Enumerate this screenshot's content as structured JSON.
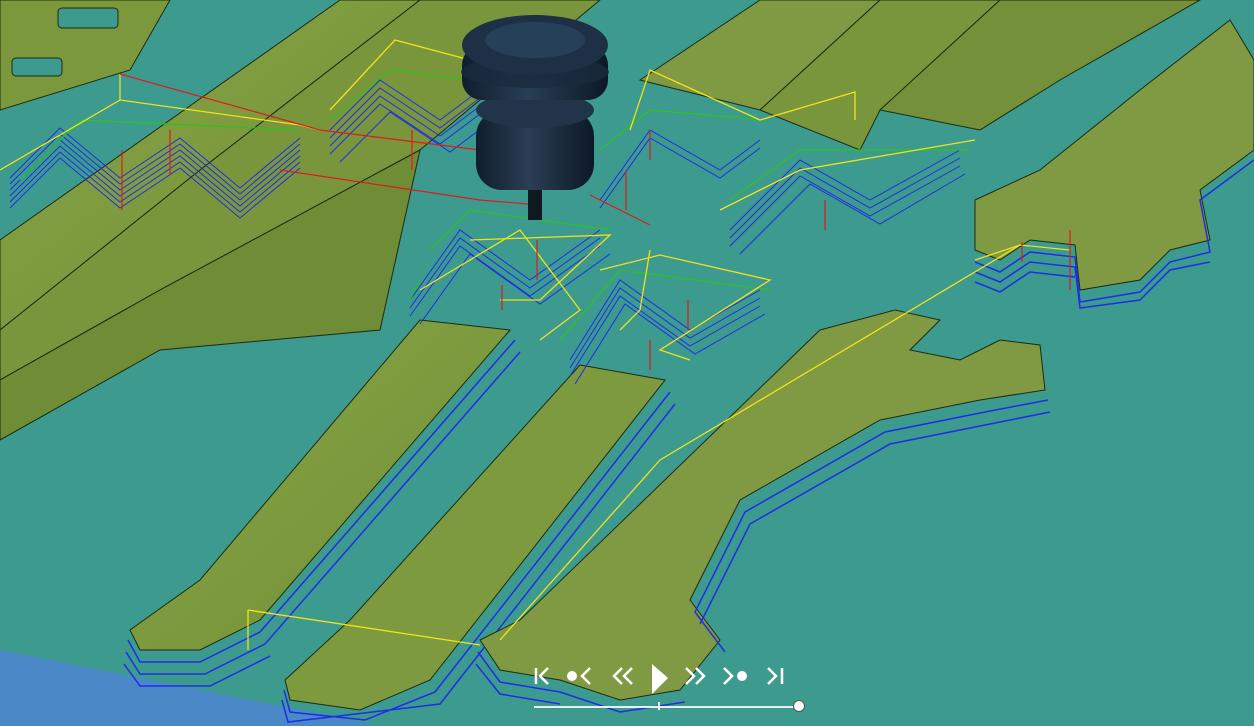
{
  "viewer": {
    "background": "#3d9a8e",
    "stock_color": "#7f9a42",
    "stock_top_color": "#8fa84a",
    "stock_side_color": "#6c8532",
    "toolpath_cut_color": "#1f2ee6",
    "toolpath_lead_color": "#f2e21a",
    "toolpath_entry_color": "#2ec21c",
    "toolpath_plunge_color": "#e01b1b",
    "tool_body_color": "#1a2c40"
  },
  "playback": {
    "buttons": [
      {
        "name": "jump-to-start-icon"
      },
      {
        "name": "previous-operation-icon"
      },
      {
        "name": "step-back-icon"
      },
      {
        "name": "play-icon"
      },
      {
        "name": "step-forward-icon"
      },
      {
        "name": "next-operation-icon"
      },
      {
        "name": "jump-to-end-icon"
      }
    ],
    "position": 0.98
  }
}
